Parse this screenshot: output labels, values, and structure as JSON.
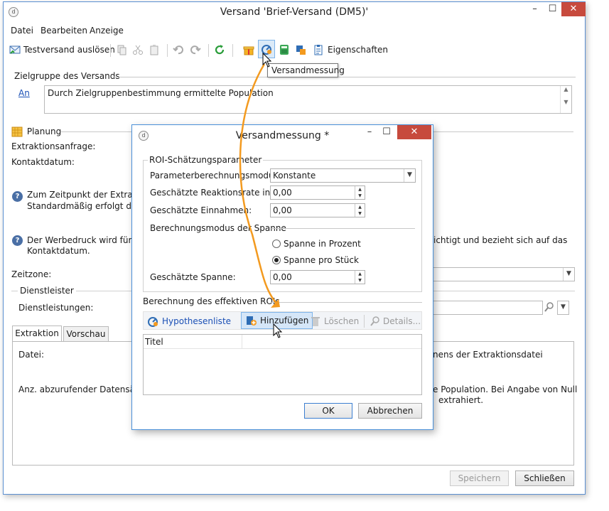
{
  "main_window": {
    "title": "Versand 'Brief-Versand (DM5)'",
    "menu": [
      "Datei",
      "Bearbeiten",
      "Anzeige"
    ],
    "toolbar": {
      "test_send_label": "Testversand auslösen",
      "properties_label": "Eigenschaften",
      "tooltip": "Versandmessung"
    },
    "target": {
      "section_label": "Zielgruppe des Versands",
      "link_label": "An",
      "value": "Durch Zielgruppenbestimmung ermittelte Population"
    },
    "planning": {
      "section_label": "Planung",
      "extraction_request_label": "Extraktionsanfrage:",
      "contact_date_label": "Kontaktdatum:",
      "info1_line1": "Zum Zeitpunkt der Extraktio",
      "info1_line2": "Standardmäßig erfolgt die E",
      "info2_line1_left": "Der Werbedruck wird für der",
      "info2_line1_right": "ichtigt und bezieht sich auf das",
      "info2_line2": "Kontaktdatum."
    },
    "timezone_label": "Zeitzone:",
    "provider": {
      "section_label": "Dienstleister",
      "services_label": "Dienstleistungen:"
    },
    "tabs": [
      "Extraktion",
      "Vorschau"
    ],
    "extraction": {
      "file_label": "Datei:",
      "file_hint_right": "nens der Extraktionsdatei",
      "records_label": "Anz. abzurufender Datensätze:",
      "records_hint_line1": "e Population. Bei Angabe von Null",
      "records_hint_line2": "extrahiert."
    },
    "buttons": {
      "save": "Speichern",
      "close": "Schließen"
    }
  },
  "dialog": {
    "title": "Versandmessung *",
    "roi_group_label": "ROI-Schätzungsparameter",
    "calc_mode_label": "Parameterberechnungsmodus:",
    "calc_mode_value": "Konstante",
    "response_rate_label": "Geschätzte Reaktionsrate in %:",
    "response_rate_value": "0,00",
    "revenue_label": "Geschätzte Einnahmen:",
    "revenue_value": "0,00",
    "margin_mode_label": "Berechnungsmodus der Spanne",
    "margin_percent_label": "Spanne in Prozent",
    "margin_per_piece_label": "Spanne pro Stück",
    "margin_label": "Geschätzte Spanne:",
    "margin_value": "0,00",
    "effective_roi_label": "Berechnung des effektiven ROIs",
    "toolbar": {
      "hypotheses_label": "Hypothesenliste",
      "add_label": "Hinzufügen",
      "delete_label": "Löschen",
      "details_label": "Details..."
    },
    "list_header_title": "Titel",
    "ok_label": "OK",
    "cancel_label": "Abbrechen"
  },
  "colors": {
    "accent": "#4a90d9",
    "close_button": "#c74a3d",
    "arrow": "#f39a1f"
  }
}
